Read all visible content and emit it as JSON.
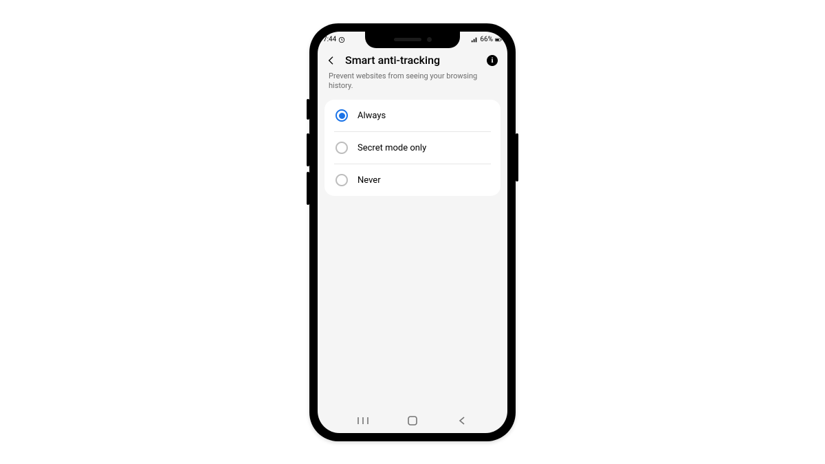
{
  "status": {
    "time": "7:44",
    "battery": "66%"
  },
  "header": {
    "title": "Smart anti-tracking",
    "subtitle": "Prevent websites from seeing your browsing history."
  },
  "options": [
    {
      "label": "Always",
      "selected": true
    },
    {
      "label": "Secret mode only",
      "selected": false
    },
    {
      "label": "Never",
      "selected": false
    }
  ],
  "accent": "#1a73e8"
}
